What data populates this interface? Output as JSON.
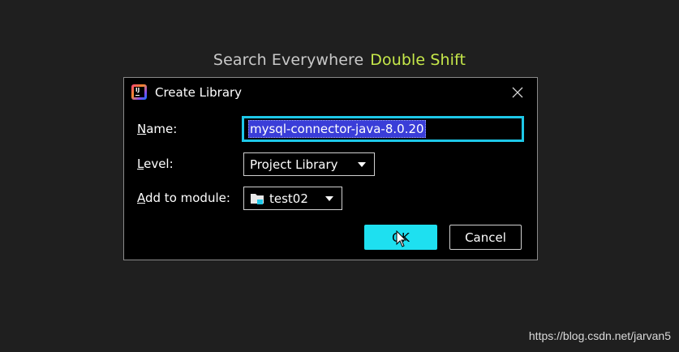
{
  "hint": {
    "label": "Search Everywhere",
    "shortcut": "Double Shift"
  },
  "dialog": {
    "title": "Create Library",
    "app_icon": "intellij-idea-icon",
    "close_icon": "close-icon",
    "name_label_mnemonic": "N",
    "name_label_rest": "ame:",
    "name_value": "mysql-connector-java-8.0.20",
    "level_label_mnemonic": "L",
    "level_label_rest": "evel:",
    "level_value": "Project Library",
    "module_label_mnemonic": "A",
    "module_label_rest": "dd to module:",
    "module_value": "test02",
    "module_icon": "module-folder-icon",
    "ok_label": "OK",
    "cancel_label": "Cancel"
  },
  "watermark": "https://blog.csdn.net/jarvan5",
  "colors": {
    "accent": "#1ee0f0",
    "focus_border": "#1ec8e8",
    "selection": "#3a3dd8",
    "hint_shortcut": "#c6e84a"
  }
}
